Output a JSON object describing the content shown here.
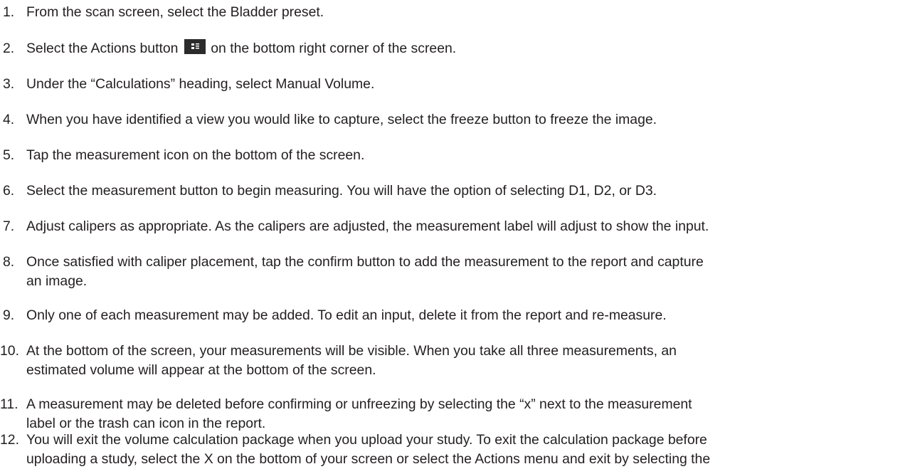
{
  "steps": [
    {
      "number": "1.",
      "lines": [
        "From the scan screen, select the Bladder preset."
      ]
    },
    {
      "number": "2.",
      "before_icon": "Select the Actions button",
      "icon": "actions-menu-icon",
      "after_icon": "on the bottom right corner of the screen."
    },
    {
      "number": "3.",
      "lines": [
        "Under the “Calculations” heading, select Manual Volume."
      ]
    },
    {
      "number": "4.",
      "lines": [
        "When you have identified a view you would like to capture, select the freeze button to freeze the image."
      ]
    },
    {
      "number": "5.",
      "lines": [
        "Tap the measurement icon on the bottom of the screen."
      ]
    },
    {
      "number": "6.",
      "lines": [
        "Select the measurement button to begin measuring. You will have the option of selecting D1, D2, or D3."
      ]
    },
    {
      "number": "7.",
      "lines": [
        "Adjust calipers as appropriate. As the calipers are adjusted, the measurement label will adjust to show the input."
      ]
    },
    {
      "number": "8.",
      "lines": [
        "Once satisfied with caliper placement, tap the confirm button to add the measurement to the report and capture",
        "an image."
      ]
    },
    {
      "number": "9.",
      "lines": [
        "Only one of each measurement may be added. To edit an input, delete it from the report and re-measure."
      ]
    },
    {
      "number": "10.",
      "lines": [
        "At the bottom of the screen, your measurements will be visible. When you take all three measurements, an",
        "estimated volume will appear at the bottom of the screen."
      ]
    },
    {
      "number": "11.",
      "lines": [
        "A measurement may be deleted before confirming or unfreezing by selecting the “x” next to the measurement",
        "label or the trash can icon in the report."
      ]
    },
    {
      "number": "12.",
      "lines": [
        "You will exit the volume calculation package when you upload your study. To exit the calculation package before",
        "uploading a study, select the X on the bottom of your screen or select the Actions menu and exit by selecting the"
      ]
    }
  ],
  "colors": {
    "text": "#231f20",
    "icon_background": "#2b2b2b",
    "icon_foreground": "#ffffff"
  }
}
